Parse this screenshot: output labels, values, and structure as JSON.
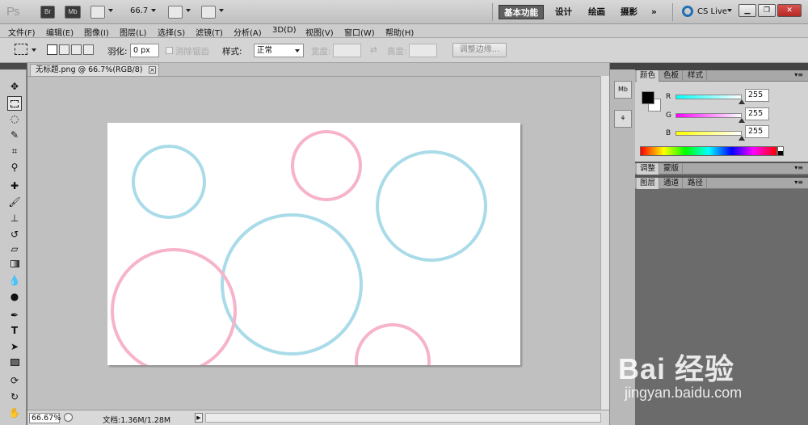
{
  "app": {
    "logo": "Ps",
    "bridge": "Br",
    "minibridge": "Mb",
    "zoom": "66.7",
    "workspaces": [
      "基本功能",
      "设计",
      "绘画",
      "摄影"
    ],
    "more": "»",
    "cslive": "CS Live"
  },
  "menu": [
    "文件(F)",
    "编辑(E)",
    "图像(I)",
    "图层(L)",
    "选择(S)",
    "滤镜(T)",
    "分析(A)",
    "3D(D)",
    "视图(V)",
    "窗口(W)",
    "帮助(H)"
  ],
  "options": {
    "feather_label": "羽化:",
    "feather_value": "0 px",
    "antialias_label": "消除锯齿",
    "style_label": "样式:",
    "style_value": "正常",
    "width_label": "宽度:",
    "height_label": "高度:",
    "refine_edge": "调整边缘..."
  },
  "document": {
    "tab_title": "无标题.png @ 66.7%(RGB/8)",
    "zoom_status": "66.67%",
    "doc_status": "文档:1.36M/1.28M"
  },
  "canvas": {
    "circles": [
      {
        "color": "#a9dbe8"
      },
      {
        "color": "#f7b3c9"
      },
      {
        "color": "#a9dbe8"
      },
      {
        "color": "#a9dbe8"
      },
      {
        "color": "#f7b3c9"
      },
      {
        "color": "#f7b3c9"
      }
    ]
  },
  "panels": {
    "color_tabs": [
      "颜色",
      "色板",
      "样式"
    ],
    "adjust_tabs": [
      "调整",
      "蒙版"
    ],
    "layer_tabs": [
      "图层",
      "通道",
      "路径"
    ],
    "r_label": "R",
    "g_label": "G",
    "b_label": "B",
    "r_value": "255",
    "g_value": "255",
    "b_value": "255"
  },
  "watermark": {
    "main": "Bai 经验",
    "sub": "jingyan.baidu.com"
  },
  "colors": {
    "cyan_circle": "#a9dbe8",
    "pink_circle": "#f7b3c9"
  }
}
